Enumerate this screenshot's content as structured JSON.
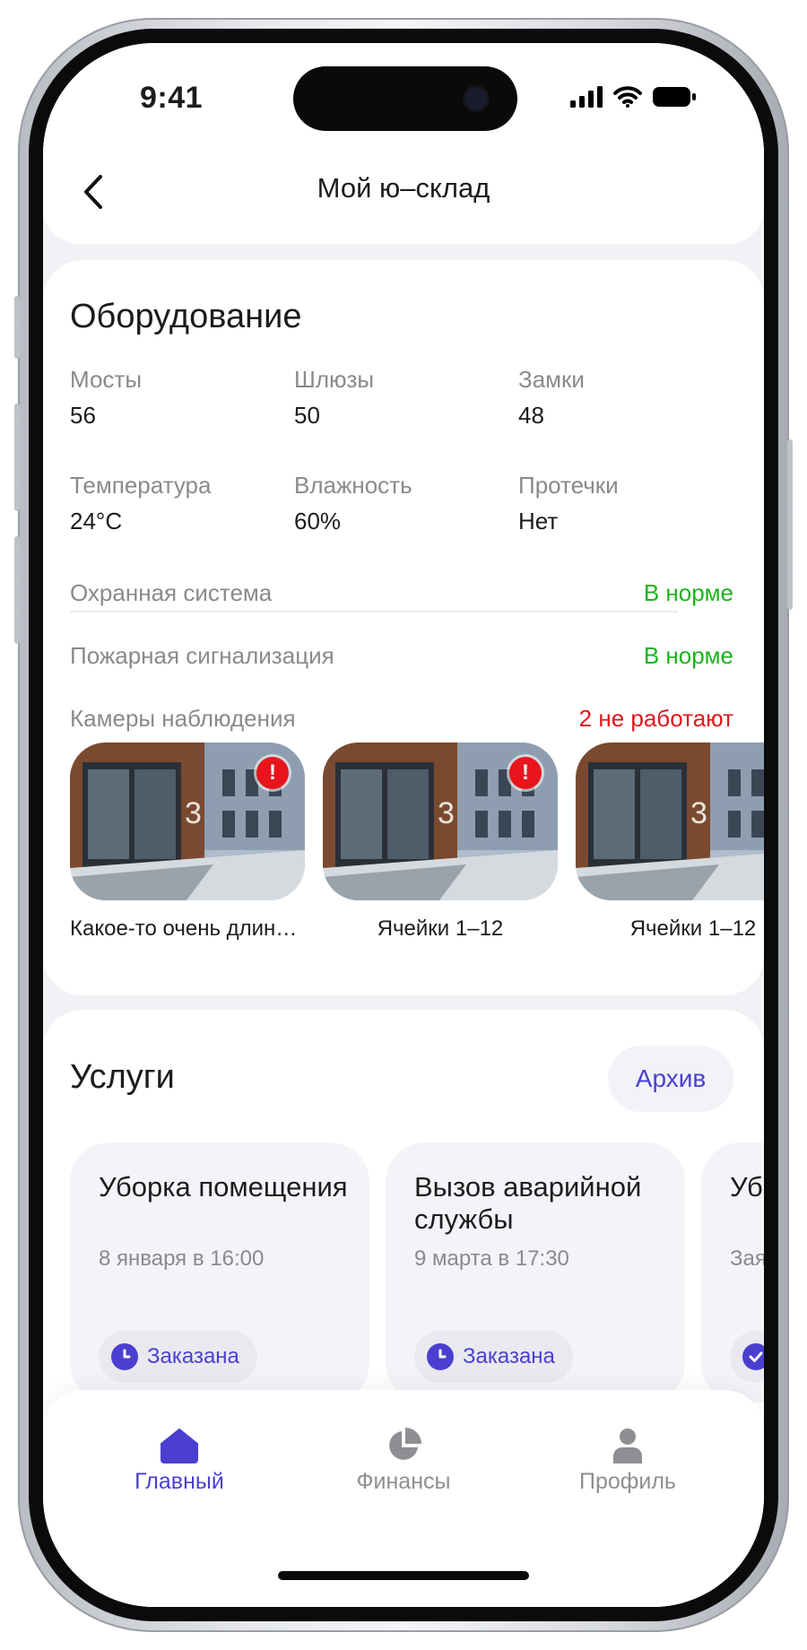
{
  "status_bar": {
    "time": "9:41"
  },
  "header": {
    "title": "Мой ю–склад",
    "back_icon": "chevron-left-icon"
  },
  "equipment": {
    "title": "Оборудование",
    "metrics": [
      {
        "label": "Мосты",
        "value": "56"
      },
      {
        "label": "Шлюзы",
        "value": "50"
      },
      {
        "label": "Замки",
        "value": "48"
      },
      {
        "label": "Температура",
        "value": "24°C"
      },
      {
        "label": "Влажность",
        "value": "60%"
      },
      {
        "label": "Протечки",
        "value": "Нет"
      }
    ],
    "systems": [
      {
        "label": "Охранная система",
        "value": "В норме",
        "status_color": "#1db31d"
      },
      {
        "label": "Пожарная сигнализация",
        "value": "В норме",
        "status_color": "#1db31d"
      },
      {
        "label": "Камеры наблюдения",
        "value": "2 не работают",
        "status_color": "#e0161d"
      }
    ],
    "cameras": [
      {
        "caption": "Какое-то очень длинное название",
        "alert": "!"
      },
      {
        "caption": "Ячейки 1–12",
        "alert": "!"
      },
      {
        "caption": "Ячейки 1–12",
        "alert": ""
      }
    ]
  },
  "services": {
    "title": "Услуги",
    "archive_label": "Архив",
    "items": [
      {
        "title": "Уборка помещения",
        "date": "8 января в 16:00",
        "status": "Заказана",
        "status_icon": "clock-icon"
      },
      {
        "title": "Вызов аварийной службы",
        "date": "9 марта в 17:30",
        "status": "Заказана",
        "status_icon": "clock-icon"
      },
      {
        "title": "Уборка помещения",
        "date": "Заявка",
        "status": "",
        "status_icon": "check-icon"
      }
    ]
  },
  "tab_bar": {
    "items": [
      {
        "label": "Главный",
        "icon": "home-icon",
        "active": true
      },
      {
        "label": "Финансы",
        "icon": "pie-chart-icon",
        "active": false
      },
      {
        "label": "Профиль",
        "icon": "user-icon",
        "active": false
      }
    ]
  },
  "colors": {
    "accent": "#4b3fd0",
    "ok": "#1db31d",
    "error": "#e0161d"
  }
}
